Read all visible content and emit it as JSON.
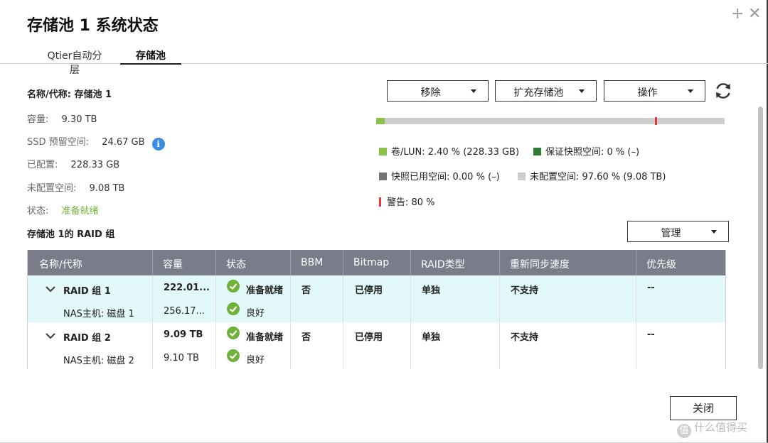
{
  "window": {
    "title": "存储池 1 系统状态",
    "add_glyph": "+",
    "close_glyph": "✕"
  },
  "tabs": [
    {
      "label": "Qtier自动分层",
      "active": false
    },
    {
      "label": "存储池",
      "active": true
    }
  ],
  "info": {
    "name_label": "名称/代称:",
    "name_value": "存储池 1",
    "capacity_label": "容量:",
    "capacity_value": "9.30 TB",
    "ssd_label": "SSD 预留空间:",
    "ssd_value": "24.67 GB",
    "ssd_info_glyph": "i",
    "allocated_label": "已配置:",
    "allocated_value": "228.33 GB",
    "unallocated_label": "未配置空间:",
    "unallocated_value": "9.08 TB",
    "status_label": "状态:",
    "status_value": "准备就绪"
  },
  "actions": {
    "remove": "移除",
    "expand": "扩充存储池",
    "operate": "操作",
    "manage": "管理"
  },
  "usage": {
    "used_percent": 2.4,
    "warning_percent": 80
  },
  "legend": {
    "volume": "卷/LUN: 2.40 % (228.33 GB)",
    "guaranteed": "保证快照空间: 0 % (–)",
    "snapshot": "快照已用空间: 0.00 % (–)",
    "unallocated": "未配置空间: 97.60 % (9.08 TB)",
    "warning": "警告: 80 %"
  },
  "colors": {
    "volume": "#8bc34a",
    "guaranteed": "#2e7d32",
    "snapshot": "#757575",
    "unallocated": "#cdcdcd",
    "warning": "#e53935",
    "header": "#7a7d89",
    "ready": "#6fb23a",
    "row_highlight": "#e3f8f8"
  },
  "raid": {
    "section_title": "存储池 1的 RAID 组",
    "columns": [
      "名称/代称",
      "容量",
      "状态",
      "BBM",
      "Bitmap",
      "RAID类型",
      "重新同步速度",
      "优先级"
    ],
    "groups": [
      {
        "name": "RAID 组 1",
        "capacity": "222.01...",
        "status": "准备就绪",
        "bbm": "否",
        "bitmap": "已停用",
        "raid_type": "单独",
        "resync": "不支持",
        "priority": "--",
        "disk_name": "NAS主机: 磁盘 1",
        "disk_capacity": "256.17...",
        "disk_status": "良好"
      },
      {
        "name": "RAID 组 2",
        "capacity": "9.09 TB",
        "status": "准备就绪",
        "bbm": "否",
        "bitmap": "已停用",
        "raid_type": "单独",
        "resync": "不支持",
        "priority": "--",
        "disk_name": "NAS主机: 磁盘 2",
        "disk_capacity": "9.10 TB",
        "disk_status": "良好"
      }
    ]
  },
  "footer": {
    "close": "关闭",
    "watermark": "什么值得买",
    "watermark_logo": "值"
  }
}
